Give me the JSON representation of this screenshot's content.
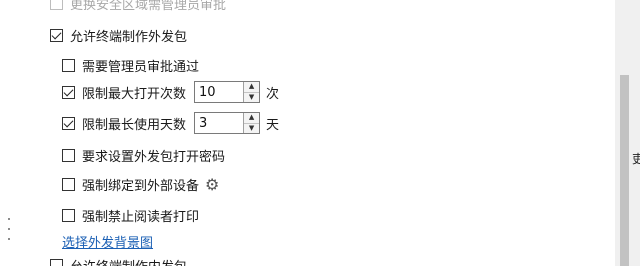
{
  "options": {
    "top_cut": {
      "label": "更换安全区域需管理员审批",
      "checked": false
    },
    "allow_terminal_pack": {
      "label": "允许终端制作外发包",
      "checked": true
    },
    "need_admin_approval": {
      "label": "需要管理员审批通过",
      "checked": false
    },
    "limit_open_count": {
      "label": "限制最大打开次数",
      "checked": true,
      "value": "10",
      "unit": "次"
    },
    "limit_use_days": {
      "label": "限制最长使用天数",
      "checked": true,
      "value": "3",
      "unit": "天"
    },
    "require_password": {
      "label": "要求设置外发包打开密码",
      "checked": false
    },
    "bind_external_device": {
      "label": "强制绑定到外部设备",
      "checked": false,
      "icon": "gear-icon"
    },
    "forbid_print": {
      "label": "强制禁止阅读者打印",
      "checked": false
    },
    "background_link": "选择外发背景图",
    "bottom_cut": {
      "label": "允许终端制作内发包",
      "checked": false
    }
  },
  "edge_fragment": "吏"
}
